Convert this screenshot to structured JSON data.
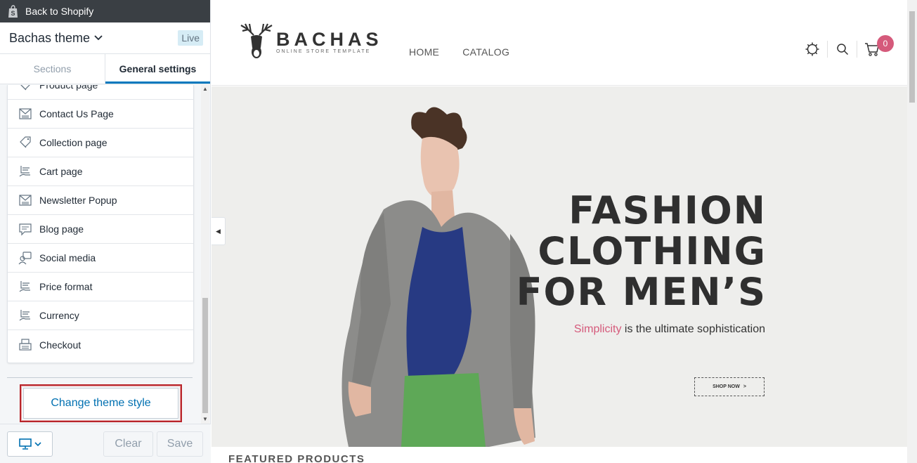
{
  "topbar": {
    "back_label": "Back to Shopify"
  },
  "theme": {
    "name": "Bachas theme",
    "status": "Live"
  },
  "tabs": [
    {
      "label": "Sections",
      "active": false
    },
    {
      "label": "General settings",
      "active": true
    }
  ],
  "settings_items": [
    {
      "label": "Product page",
      "icon": "tag-icon"
    },
    {
      "label": "Contact Us Page",
      "icon": "newsletter-icon"
    },
    {
      "label": "Collection page",
      "icon": "tag-icon"
    },
    {
      "label": "Cart page",
      "icon": "hand-card-icon"
    },
    {
      "label": "Newsletter Popup",
      "icon": "newsletter-icon"
    },
    {
      "label": "Blog page",
      "icon": "comment-icon"
    },
    {
      "label": "Social media",
      "icon": "social-icon"
    },
    {
      "label": "Price format",
      "icon": "hand-card-icon"
    },
    {
      "label": "Currency",
      "icon": "hand-card-icon"
    },
    {
      "label": "Checkout",
      "icon": "register-icon"
    }
  ],
  "change_theme": {
    "label": "Change theme style"
  },
  "footer": {
    "clear_label": "Clear",
    "save_label": "Save"
  },
  "store": {
    "logo_name": "BACHAS",
    "logo_tagline": "ONLINE STORE TEMPLATE",
    "nav": [
      "HOME",
      "CATALOG"
    ],
    "cart_count": "0",
    "hero_line1": "FASHION",
    "hero_line2": "CLOTHING",
    "hero_line3": "FOR MEN’S",
    "hero_sub_highlight": "Simplicity",
    "hero_sub_rest": " is the ultimate sophistication",
    "shop_now": "SHOP NOW",
    "featured": "FEATURED PRODUCTS"
  },
  "colors": {
    "accent": "#0078bd",
    "badge": "#d55a7b",
    "highlight_box": "#b8252b"
  }
}
